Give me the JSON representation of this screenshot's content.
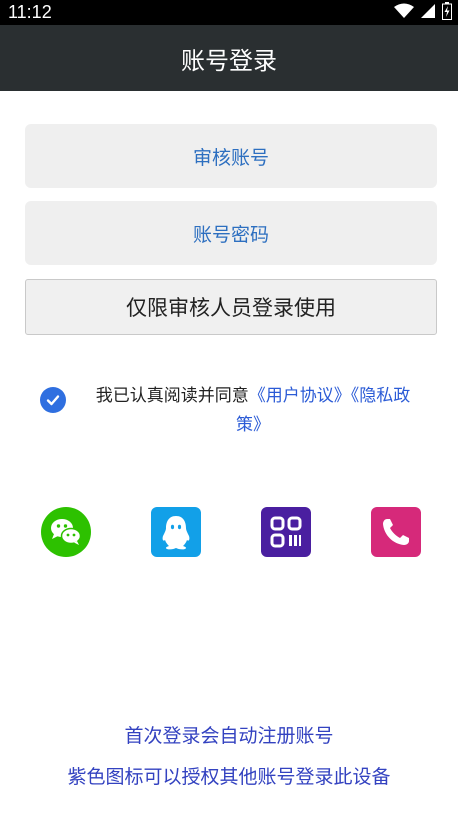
{
  "status": {
    "time": "11:12"
  },
  "header": {
    "title": "账号登录"
  },
  "form": {
    "account_label": "审核账号",
    "password_label": "账号密码",
    "login_button": "仅限审核人员登录使用"
  },
  "agreement": {
    "text": "我已认真阅读并同意",
    "user_agreement": "《用户协议》",
    "privacy_policy_part1": "《隐私政",
    "privacy_policy_part2": "策》",
    "checked": true
  },
  "social_login": [
    {
      "icon": "wechat-icon",
      "color": "#2dc100"
    },
    {
      "icon": "qq-icon",
      "color": "#12a0e8"
    },
    {
      "icon": "qr-code-icon",
      "color": "#4a1fa0"
    },
    {
      "icon": "phone-icon",
      "color": "#d6297a"
    }
  ],
  "footer": {
    "line1": "首次登录会自动注册账号",
    "line2": "紫色图标可以授权其他账号登录此设备"
  }
}
